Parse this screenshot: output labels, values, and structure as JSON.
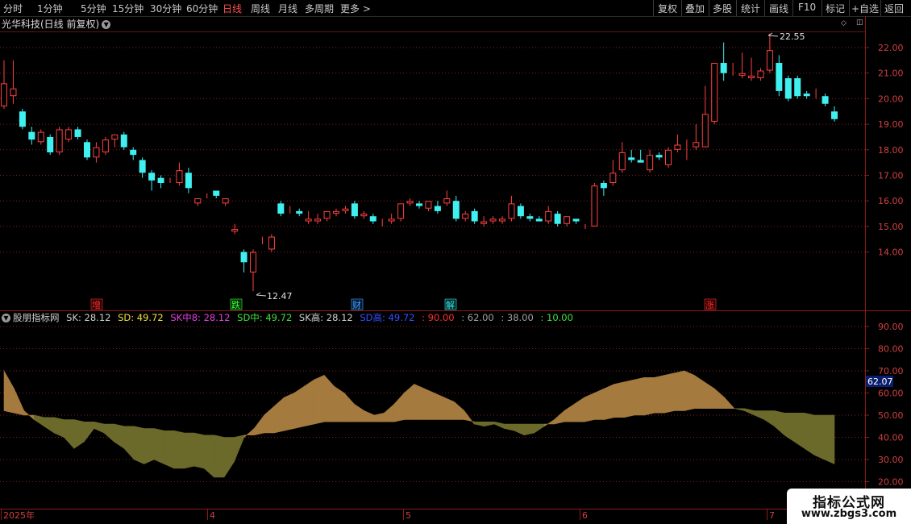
{
  "toolbar": {
    "timeframes": [
      "分时",
      "1分钟",
      "5分钟",
      "15分钟",
      "30分钟",
      "60分钟",
      "日线",
      "周线",
      "月线",
      "多周期",
      "更多 >"
    ],
    "active_timeframe": "日线",
    "right_buttons": [
      "复权",
      "叠加",
      "多股",
      "统计",
      "画线",
      "F10",
      "+自选",
      "返回"
    ],
    "right_labels_extra": "标记"
  },
  "stock": {
    "title": "光华科技(日线 前复权)"
  },
  "price_axis": {
    "labels": [
      "22.00",
      "21.00",
      "20.00",
      "19.00",
      "18.00",
      "17.00",
      "16.00",
      "15.00",
      "14.00"
    ]
  },
  "annotations": {
    "high_label": "22.55",
    "low_label": "12.47"
  },
  "event_tags": [
    {
      "label": "增",
      "color": "#ff3030"
    },
    {
      "label": "跌",
      "color": "#40ff40"
    },
    {
      "label": "财",
      "color": "#4aa0ff"
    },
    {
      "label": "解",
      "color": "#40e0e0"
    },
    {
      "label": "涨",
      "color": "#ff3030"
    }
  ],
  "indicator": {
    "name": "股朋指标网",
    "legend": [
      {
        "text": "SK: 28.12",
        "color": "#d0d0d0"
      },
      {
        "text": "SD: 49.72",
        "color": "#f0e040"
      },
      {
        "text": "SK中8: 28.12",
        "color": "#e040e0"
      },
      {
        "text": "SD中: 49.72",
        "color": "#40e040"
      },
      {
        "text": "SK高: 28.12",
        "color": "#d0d0d0"
      },
      {
        "text": "SD高: 49.72",
        "color": "#3050ff"
      },
      {
        "text": ": 90.00",
        "color": "#ff3030"
      },
      {
        "text": ": 62.00",
        "color": "#a0a0a0"
      },
      {
        "text": ": 38.00",
        "color": "#a0a0a0"
      },
      {
        "text": ": 10.00",
        "color": "#40e040"
      }
    ],
    "axis_labels": [
      "90.00",
      "80.00",
      "70.00",
      "60.00",
      "50.00",
      "40.00",
      "30.00",
      "20.00"
    ],
    "current_value": "62.07"
  },
  "date_axis": {
    "labels": [
      "2025年",
      "4",
      "5",
      "6",
      "7"
    ]
  },
  "watermark": {
    "line1": "指标公式网",
    "line2": "www.zbgs3.com"
  },
  "colors": {
    "up": "#ff4040",
    "down": "#40f0f0",
    "grid": "#8a1a1a",
    "fill_up": "#a47a3e",
    "fill_down": "#6b6a2a"
  },
  "candles": [
    {
      "o": 19.7,
      "h": 21.5,
      "l": 19.6,
      "c": 20.6
    },
    {
      "o": 20.1,
      "h": 21.5,
      "l": 19.8,
      "c": 20.4
    },
    {
      "o": 19.5,
      "h": 19.6,
      "l": 18.8,
      "c": 18.9
    },
    {
      "o": 18.7,
      "h": 18.9,
      "l": 18.2,
      "c": 18.4
    },
    {
      "o": 18.3,
      "h": 18.8,
      "l": 18.2,
      "c": 18.7
    },
    {
      "o": 18.5,
      "h": 18.6,
      "l": 17.8,
      "c": 17.9
    },
    {
      "o": 17.9,
      "h": 18.9,
      "l": 17.8,
      "c": 18.8
    },
    {
      "o": 18.4,
      "h": 18.9,
      "l": 18.3,
      "c": 18.8
    },
    {
      "o": 18.8,
      "h": 18.9,
      "l": 18.4,
      "c": 18.5
    },
    {
      "o": 18.3,
      "h": 18.4,
      "l": 17.6,
      "c": 17.7
    },
    {
      "o": 17.7,
      "h": 18.3,
      "l": 17.5,
      "c": 18.1
    },
    {
      "o": 17.9,
      "h": 18.5,
      "l": 17.8,
      "c": 18.4
    },
    {
      "o": 18.4,
      "h": 18.6,
      "l": 18.1,
      "c": 18.6
    },
    {
      "o": 18.6,
      "h": 18.7,
      "l": 18.0,
      "c": 18.1
    },
    {
      "o": 18.0,
      "h": 18.1,
      "l": 17.6,
      "c": 17.8
    },
    {
      "o": 17.6,
      "h": 17.7,
      "l": 16.9,
      "c": 17.1
    },
    {
      "o": 17.1,
      "h": 17.2,
      "l": 16.4,
      "c": 16.8
    },
    {
      "o": 16.9,
      "h": 17.0,
      "l": 16.5,
      "c": 16.7
    },
    {
      "o": 16.8,
      "h": 16.9,
      "l": 16.7,
      "c": 16.8
    },
    {
      "o": 16.7,
      "h": 17.5,
      "l": 16.6,
      "c": 17.2
    },
    {
      "o": 17.1,
      "h": 17.3,
      "l": 16.3,
      "c": 16.5
    },
    {
      "o": 15.9,
      "h": 16.1,
      "l": 15.8,
      "c": 16.1
    },
    {
      "o": 16.2,
      "h": 16.3,
      "l": 16.1,
      "c": 16.2
    },
    {
      "o": 16.4,
      "h": 16.4,
      "l": 16.1,
      "c": 16.2
    },
    {
      "o": 15.9,
      "h": 16.1,
      "l": 15.8,
      "c": 16.1
    },
    {
      "o": 14.8,
      "h": 15.1,
      "l": 14.7,
      "c": 14.9
    },
    {
      "o": 14.0,
      "h": 14.1,
      "l": 13.2,
      "c": 13.6
    },
    {
      "o": 13.2,
      "h": 14.1,
      "l": 12.47,
      "c": 14.0
    },
    {
      "o": 14.4,
      "h": 14.6,
      "l": 14.3,
      "c": 14.4
    },
    {
      "o": 14.1,
      "h": 14.7,
      "l": 14.0,
      "c": 14.6
    },
    {
      "o": 15.9,
      "h": 16.0,
      "l": 15.4,
      "c": 15.5
    },
    {
      "o": 15.6,
      "h": 15.8,
      "l": 15.5,
      "c": 15.6
    },
    {
      "o": 15.6,
      "h": 15.7,
      "l": 15.4,
      "c": 15.5
    },
    {
      "o": 15.2,
      "h": 15.6,
      "l": 15.1,
      "c": 15.3
    },
    {
      "o": 15.2,
      "h": 15.5,
      "l": 15.1,
      "c": 15.3
    },
    {
      "o": 15.3,
      "h": 15.6,
      "l": 15.2,
      "c": 15.6
    },
    {
      "o": 15.5,
      "h": 15.7,
      "l": 15.4,
      "c": 15.6
    },
    {
      "o": 15.6,
      "h": 15.8,
      "l": 15.5,
      "c": 15.7
    },
    {
      "o": 15.9,
      "h": 16.0,
      "l": 15.3,
      "c": 15.4
    },
    {
      "o": 15.4,
      "h": 15.6,
      "l": 15.3,
      "c": 15.5
    },
    {
      "o": 15.4,
      "h": 15.5,
      "l": 15.1,
      "c": 15.2
    },
    {
      "o": 15.2,
      "h": 15.3,
      "l": 15.0,
      "c": 15.2
    },
    {
      "o": 15.2,
      "h": 15.5,
      "l": 15.1,
      "c": 15.3
    },
    {
      "o": 15.3,
      "h": 15.9,
      "l": 15.2,
      "c": 15.9
    },
    {
      "o": 15.9,
      "h": 16.1,
      "l": 15.8,
      "c": 16.0
    },
    {
      "o": 15.9,
      "h": 16.0,
      "l": 15.7,
      "c": 15.8
    },
    {
      "o": 15.7,
      "h": 16.0,
      "l": 15.6,
      "c": 16.0
    },
    {
      "o": 15.8,
      "h": 16.0,
      "l": 15.5,
      "c": 15.6
    },
    {
      "o": 15.9,
      "h": 16.4,
      "l": 15.8,
      "c": 16.1
    },
    {
      "o": 16.0,
      "h": 16.2,
      "l": 15.2,
      "c": 15.3
    },
    {
      "o": 15.3,
      "h": 15.6,
      "l": 15.2,
      "c": 15.5
    },
    {
      "o": 15.6,
      "h": 15.7,
      "l": 15.1,
      "c": 15.2
    },
    {
      "o": 15.1,
      "h": 15.4,
      "l": 15.0,
      "c": 15.2
    },
    {
      "o": 15.2,
      "h": 15.4,
      "l": 15.1,
      "c": 15.3
    },
    {
      "o": 15.2,
      "h": 15.4,
      "l": 15.1,
      "c": 15.3
    },
    {
      "o": 15.3,
      "h": 16.2,
      "l": 15.2,
      "c": 15.9
    },
    {
      "o": 15.8,
      "h": 15.9,
      "l": 15.3,
      "c": 15.4
    },
    {
      "o": 15.4,
      "h": 15.5,
      "l": 15.2,
      "c": 15.3
    },
    {
      "o": 15.3,
      "h": 15.4,
      "l": 15.2,
      "c": 15.2
    },
    {
      "o": 15.2,
      "h": 15.8,
      "l": 15.1,
      "c": 15.6
    },
    {
      "o": 15.5,
      "h": 15.6,
      "l": 15.0,
      "c": 15.1
    },
    {
      "o": 15.1,
      "h": 15.4,
      "l": 15.0,
      "c": 15.4
    },
    {
      "o": 15.3,
      "h": 15.3,
      "l": 15.1,
      "c": 15.2
    },
    {
      "o": 15.0,
      "h": 15.1,
      "l": 14.9,
      "c": 15.0
    },
    {
      "o": 15.0,
      "h": 16.7,
      "l": 15.0,
      "c": 16.6
    },
    {
      "o": 16.7,
      "h": 16.8,
      "l": 16.2,
      "c": 16.5
    },
    {
      "o": 16.7,
      "h": 17.6,
      "l": 16.6,
      "c": 17.1
    },
    {
      "o": 17.2,
      "h": 18.3,
      "l": 17.1,
      "c": 17.9
    },
    {
      "o": 17.7,
      "h": 18.0,
      "l": 17.5,
      "c": 17.6
    },
    {
      "o": 17.6,
      "h": 18.0,
      "l": 17.5,
      "c": 17.5
    },
    {
      "o": 17.2,
      "h": 18.0,
      "l": 17.1,
      "c": 17.8
    },
    {
      "o": 17.8,
      "h": 17.9,
      "l": 17.6,
      "c": 17.7
    },
    {
      "o": 17.4,
      "h": 18.1,
      "l": 17.3,
      "c": 18.0
    },
    {
      "o": 18.0,
      "h": 18.6,
      "l": 17.9,
      "c": 18.2
    },
    {
      "o": 18.3,
      "h": 18.4,
      "l": 17.6,
      "c": 18.3
    },
    {
      "o": 18.1,
      "h": 19.0,
      "l": 18.0,
      "c": 18.3
    },
    {
      "o": 18.1,
      "h": 20.5,
      "l": 18.1,
      "c": 19.4
    },
    {
      "o": 19.1,
      "h": 21.4,
      "l": 19.0,
      "c": 21.4
    },
    {
      "o": 21.4,
      "h": 22.2,
      "l": 20.7,
      "c": 21.0
    },
    {
      "o": 21.0,
      "h": 21.4,
      "l": 20.9,
      "c": 21.0
    },
    {
      "o": 20.9,
      "h": 21.8,
      "l": 20.8,
      "c": 21.0
    },
    {
      "o": 20.8,
      "h": 21.6,
      "l": 20.7,
      "c": 20.9
    },
    {
      "o": 20.8,
      "h": 21.2,
      "l": 20.7,
      "c": 21.1
    },
    {
      "o": 21.1,
      "h": 22.55,
      "l": 21.0,
      "c": 21.9
    },
    {
      "o": 21.4,
      "h": 21.7,
      "l": 20.1,
      "c": 20.3
    },
    {
      "o": 20.8,
      "h": 20.9,
      "l": 19.9,
      "c": 20.0
    },
    {
      "o": 20.8,
      "h": 20.9,
      "l": 20.0,
      "c": 20.1
    },
    {
      "o": 20.2,
      "h": 20.3,
      "l": 20.0,
      "c": 20.1
    },
    {
      "o": 20.1,
      "h": 20.4,
      "l": 20.0,
      "c": 20.1
    },
    {
      "o": 20.1,
      "h": 20.2,
      "l": 19.7,
      "c": 19.8
    },
    {
      "o": 19.5,
      "h": 19.7,
      "l": 19.1,
      "c": 19.2
    }
  ],
  "oscillator": {
    "sk": [
      70,
      62,
      52,
      48,
      45,
      42,
      40,
      35,
      38,
      44,
      42,
      38,
      35,
      30,
      28,
      30,
      28,
      26,
      26,
      27,
      26,
      22,
      22,
      29,
      40,
      44,
      50,
      54,
      58,
      60,
      63,
      66,
      68,
      63,
      60,
      55,
      52,
      50,
      51,
      55,
      60,
      64,
      62,
      60,
      58,
      56,
      52,
      46,
      45,
      46,
      44,
      43,
      41,
      42,
      45,
      48,
      52,
      55,
      58,
      60,
      62,
      64,
      65,
      66,
      67,
      67,
      68,
      69,
      70,
      68,
      65,
      62,
      58,
      53,
      52,
      50,
      48,
      45,
      41,
      38,
      35,
      32,
      30,
      28
    ],
    "sd": [
      52,
      51,
      50,
      50,
      49,
      49,
      48,
      48,
      47,
      47,
      46,
      46,
      45,
      45,
      44,
      44,
      43,
      43,
      42,
      42,
      41,
      41,
      40,
      40,
      41,
      41,
      42,
      42,
      43,
      44,
      45,
      46,
      47,
      47,
      47,
      47,
      47,
      47,
      47,
      47,
      48,
      48,
      48,
      48,
      48,
      48,
      48,
      47,
      47,
      47,
      46,
      46,
      46,
      46,
      46,
      46,
      47,
      47,
      47,
      48,
      48,
      49,
      49,
      50,
      50,
      51,
      51,
      52,
      52,
      53,
      53,
      53,
      53,
      53,
      53,
      52,
      52,
      52,
      51,
      51,
      51,
      50,
      50,
      50
    ]
  }
}
